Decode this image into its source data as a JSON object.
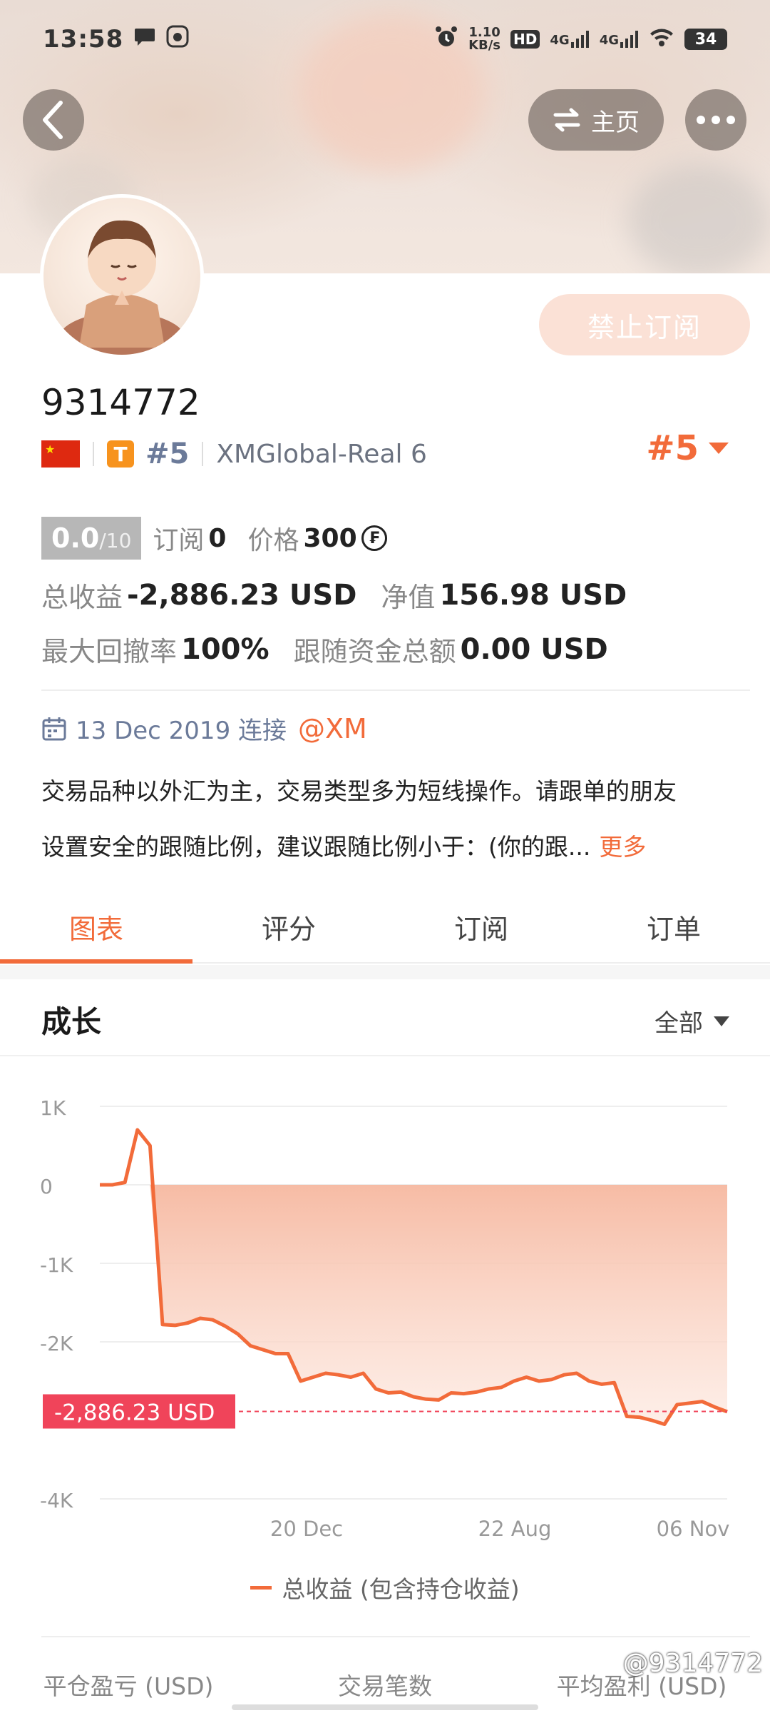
{
  "status_bar": {
    "time": "13:58",
    "net_speed_value": "1.10",
    "net_speed_unit": "KB/s",
    "hd_label": "HD",
    "signal1": "4G",
    "signal2": "4G",
    "battery": "34"
  },
  "header": {
    "back_icon": "chevron-left-icon",
    "home_label": "主页",
    "switch_icon": "swap-arrows-icon",
    "more_icon": "more-dots-icon"
  },
  "profile": {
    "unsubscribe_label": "禁止订阅",
    "username": "9314772",
    "country_flag": "china-flag",
    "tier_badge": "T",
    "rank_small": "#5",
    "server": "XMGlobal-Real 6",
    "rank_big": "#5"
  },
  "stats": {
    "score_value": "0.0",
    "score_max": "/10",
    "subscribe_label": "订阅",
    "subscribe_value": "0",
    "price_label": "价格",
    "price_value": "300",
    "coin_symbol": "₣",
    "total_profit_label": "总收益",
    "total_profit_value": "-2,886.23 USD",
    "net_value_label": "净值",
    "net_value_value": "156.98 USD",
    "max_drawdown_label": "最大回撤率",
    "max_drawdown_value": "100%",
    "follow_funds_label": "跟随资金总额",
    "follow_funds_value": "0.00 USD"
  },
  "connect": {
    "date_text": "13 Dec 2019 连接",
    "broker": "@XM"
  },
  "description": {
    "line1": "交易品种以外汇为主，交易类型多为短线操作。请跟单的朋友",
    "line2": "设置安全的跟随比例，建议跟随比例小于：(你的跟...",
    "more_label": "更多"
  },
  "tabs": [
    {
      "label": "图表",
      "active": true
    },
    {
      "label": "评分",
      "active": false
    },
    {
      "label": "订阅",
      "active": false
    },
    {
      "label": "订单",
      "active": false
    }
  ],
  "growth": {
    "title": "成长",
    "range_label": "全部"
  },
  "chart_data": {
    "type": "area",
    "y_ticks": [
      "1K",
      "0",
      "-1K",
      "-2K",
      "-4K"
    ],
    "ylim": [
      -4000,
      1000
    ],
    "x_tick_labels": [
      "20 Dec",
      "22 Aug",
      "06 Nov"
    ],
    "current_value": -2886.23,
    "current_label": "-2,886.23 USD",
    "series": [
      {
        "name": "总收益 (包含持仓收益)",
        "values": [
          0,
          0,
          30,
          700,
          500,
          -1780,
          -1790,
          -1760,
          -1700,
          -1720,
          -1800,
          -1900,
          -2050,
          -2100,
          -2150,
          -2150,
          -2500,
          -2450,
          -2400,
          -2420,
          -2450,
          -2400,
          -2600,
          -2650,
          -2640,
          -2700,
          -2730,
          -2740,
          -2650,
          -2660,
          -2640,
          -2600,
          -2580,
          -2500,
          -2450,
          -2500,
          -2480,
          -2420,
          -2400,
          -2500,
          -2540,
          -2520,
          -2950,
          -2960,
          -3000,
          -3050,
          -2800,
          -2780,
          -2760,
          -2830,
          -2890
        ]
      }
    ],
    "grid": true,
    "legend_position": "bottom"
  },
  "legend": {
    "label": "总收益 (包含持仓收益)"
  },
  "bottom_stats": {
    "col1": "平仓盈亏 (USD)",
    "col2": "交易笔数",
    "col3": "平均盈利 (USD)"
  },
  "watermark": "@9314772",
  "colors": {
    "accent": "#f26b3a",
    "label_red": "#f0445a",
    "area_top": "#f6b8a0"
  }
}
